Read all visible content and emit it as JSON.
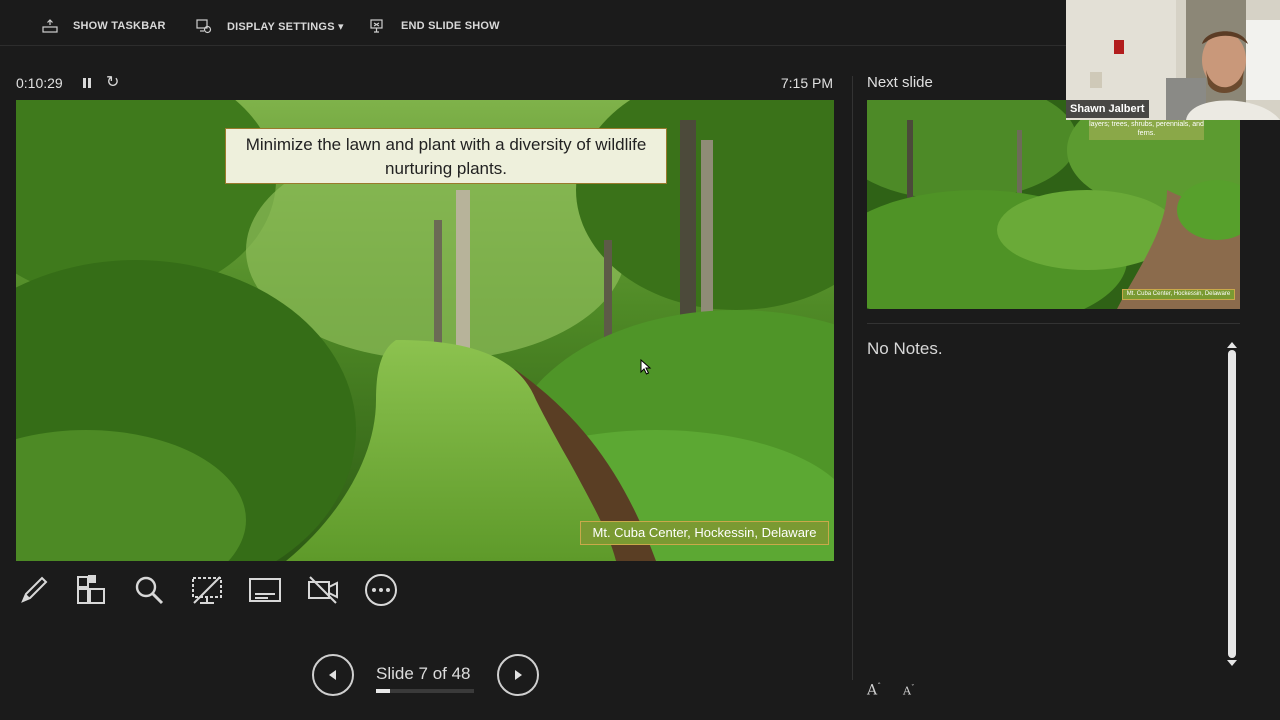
{
  "toolbar": {
    "show_taskbar": "SHOW TASKBAR",
    "display_settings": "DISPLAY SETTINGS ▾",
    "end_slide_show": "END SLIDE SHOW"
  },
  "presenter": {
    "timer": "0:10:29",
    "clock": "7:15 PM"
  },
  "current_slide": {
    "title": "Minimize the lawn and plant with a diversity of wildlife nurturing plants.",
    "caption": "Mt. Cuba Center, Hockessin, Delaware"
  },
  "tools": [
    "pen-tool",
    "slide-grid",
    "zoom",
    "black-screen",
    "subtitles",
    "camera-off",
    "more-options"
  ],
  "navigation": {
    "counter": "Slide 7 of 48",
    "current": 7,
    "total": 48,
    "progress_fraction": 0.146
  },
  "next_slide": {
    "label": "Next slide",
    "caption_top": "layers; trees, shrubs, perennials, and ferns.",
    "caption_bottom": "Mt. Cuba Center, Hockessin, Delaware"
  },
  "notes": {
    "text": "No Notes."
  },
  "webcam": {
    "name": "Shawn Jalbert"
  },
  "colors": {
    "background": "#1b1b1b",
    "title_box": "#eef0dc",
    "caption_box": "#7a9a32"
  }
}
